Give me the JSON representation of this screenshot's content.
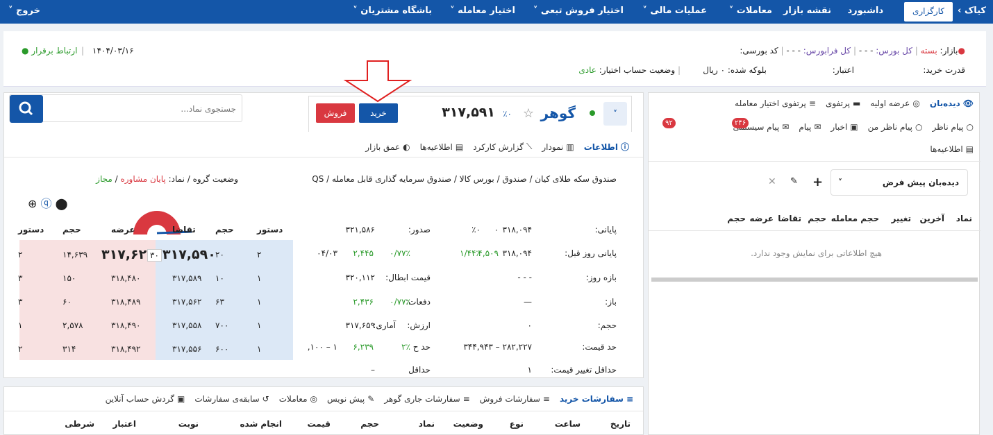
{
  "topbar": {
    "brand": "کیاک",
    "brand_sub": "کارگزاری",
    "menu": [
      "داشبورد",
      "نقشه بازار",
      "معاملات",
      "عملیات مالی",
      "اختیار فروش تبعی",
      "اختیار معامله",
      "باشگاه مشتریان"
    ],
    "exit": "خروج"
  },
  "header": {
    "market_label": "بازار:",
    "market_status": "بسته",
    "total_bourse": "کل بورس:",
    "total_farabourse": "کل فرابورس:",
    "dashes": "- - -",
    "code_label": "کد بورسی:",
    "date": "۱۴۰۴/۰۳/۱۶",
    "connection": "ارتباط برقرار",
    "buy_power": "قدرت خرید:",
    "credit": "اعتبار:",
    "blocked": "بلوکه شده: ۰ ریال",
    "option_status_label": "وضعیت حساب اختیار:",
    "option_status": "عادی"
  },
  "right": {
    "tabs1": [
      "دیده‌بان",
      "عرضه اولیه",
      "پرتفوی",
      "پرتفوی اختیار معامله"
    ],
    "tabs2": [
      "پیام ناظر",
      "پیام ناظر من",
      "اخبار",
      "پیام",
      "پیام سیستمی"
    ],
    "badge_msg": "۲۴۶",
    "badge_sys": "۹۲",
    "tabs3": "اطلاعیه‌ها",
    "watch_select": "دیده‌بان پیش فرض",
    "columns": [
      "نماد",
      "آخرین",
      "تغییر",
      "حجم معامله",
      "حجم",
      "تقاضا",
      "عرضه",
      "حجم"
    ],
    "empty": "هیچ اطلاعاتی برای نمایش وجود ندارد."
  },
  "symbol": {
    "name": "گوهر",
    "price": "۳۱۷,۵۹۱",
    "change": "٪۰",
    "buy": "خرید",
    "sell": "فروش",
    "search_placeholder": "جستجوی نماد..."
  },
  "info_tabs": [
    "اطلاعات",
    "نمودار",
    "گزارش کارکرد",
    "اطلاعیه‌ها",
    "عمق بازار"
  ],
  "breadcrumb": "صندوق سکه طلای کیان / صندوق / بورس کالا / صندوق سرمایه گذاری قابل معامله / QS",
  "group_status_label": "وضعیت گروه / نماد:",
  "group_status": "پایان مشاوره",
  "group_allow": "مجاز",
  "stats": [
    {
      "label": "پایانی:",
      "v1": "۳۱۸,۰۹۴",
      "v2": "۰",
      "v3": "٪۰",
      "l2": "صدور:",
      "v4": "۳۲۱,۵۸۶"
    },
    {
      "label": "پایانی روز قبل:",
      "v1": "۳۱۸,۰۹۴",
      "v2": "۴,۵۰۹",
      "v3": "۱/۴۴٪",
      "v5": "۰/۷۷٪",
      "v6": "۲,۴۴۵",
      "v7": "۰۴/۰۳"
    },
    {
      "label": "بازه روز:",
      "v1": "- - -",
      "l2": "قیمت ابطال:",
      "v4": "۳۲۰,۱۱۲"
    },
    {
      "label": "باز:",
      "v1": "—",
      "l2": "دفعات:",
      "v5": "۰/۷۷٪",
      "v6": "۲,۴۳۶"
    },
    {
      "label": "حجم:",
      "v1": "۰",
      "l2": "ارزش:",
      "l3": "آماری:",
      "v4": "۳۱۷,۶۵۹"
    },
    {
      "label": "حد قیمت:",
      "v1": "۲۸۲,۲۲۷ – ۳۴۴,۹۴۳",
      "l2": "حد ح",
      "v5": "۲٪",
      "v6": "۶,۲۳۹",
      "v7": "۱ – ۱۰۰,"
    },
    {
      "label": "حداقل تغییر قیمت:",
      "v1": "۱",
      "l2": "حداقل",
      "v4": "–"
    }
  ],
  "orderbook": {
    "headers": [
      "دستور",
      "حجم",
      "تقاضا",
      "عرضه",
      "حجم",
      "دستور"
    ],
    "rows": [
      [
        "۲",
        "۲۰",
        "۳۱۷,۵۹۰",
        "۳۱۷,۶۲۰",
        "۱۴,۶۳۹",
        "۲"
      ],
      [
        "۱",
        "۱۰",
        "۳۱۷,۵۸۹",
        "۳۱۸,۴۸۰",
        "۱۵۰",
        "۳"
      ],
      [
        "۱",
        "۶۳",
        "۳۱۷,۵۶۲",
        "۳۱۸,۴۸۹",
        "۶۰",
        "۳"
      ],
      [
        "۱",
        "۷۰۰",
        "۳۱۷,۵۵۸",
        "۳۱۸,۴۹۰",
        "۲,۵۷۸",
        "۱"
      ],
      [
        "۱",
        "۶۰۰",
        "۳۱۷,۵۵۶",
        "۳۱۸,۴۹۲",
        "۳۱۴",
        "۲"
      ]
    ],
    "badge": "۳۰"
  },
  "bottom_tabs": [
    "سفارشات خرید",
    "سفارشات فروش",
    "سفارشات جاری گوهر",
    "پیش نویس",
    "معاملات",
    "سابقه‌ی سفارشات",
    "گردش حساب آنلاین"
  ],
  "bottom_cols": [
    "تاریخ",
    "ساعت",
    "نوع",
    "وضعیت",
    "نماد",
    "حجم",
    "قیمت",
    "انجام شده",
    "نوبت",
    "اعتبار",
    "شرطی"
  ],
  "colors": {
    "primary": "#1456a8",
    "buy": "#1456a8",
    "sell": "#d93840",
    "green": "#2a9a2a",
    "red": "#d03030"
  }
}
